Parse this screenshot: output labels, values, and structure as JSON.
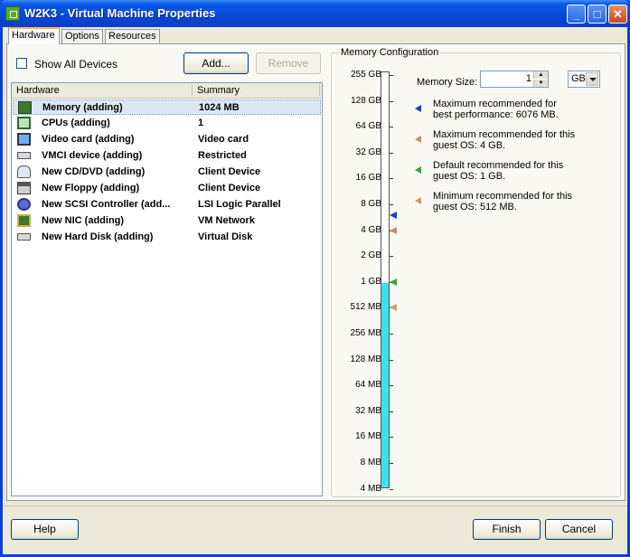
{
  "window": {
    "title": "W2K3 - Virtual Machine Properties",
    "controls": [
      "minimize-icon",
      "maximize-icon",
      "close-icon"
    ]
  },
  "tabs": [
    {
      "label": "Hardware",
      "active": true
    },
    {
      "label": "Options",
      "active": false
    },
    {
      "label": "Resources",
      "active": false
    }
  ],
  "hardware_panel": {
    "show_all_devices_label": "Show All Devices",
    "show_all_devices_checked": false,
    "add_label": "Add...",
    "remove_label": "Remove",
    "columns": [
      "Hardware",
      "Summary"
    ],
    "rows": [
      {
        "icon": "memory-icon",
        "name": "Memory (adding)",
        "summary": "1024 MB",
        "selected": true
      },
      {
        "icon": "cpu-icon",
        "name": "CPUs (adding)",
        "summary": "1",
        "selected": false
      },
      {
        "icon": "monitor-icon",
        "name": "Video card  (adding)",
        "summary": "Video card",
        "selected": false
      },
      {
        "icon": "vmci-icon",
        "name": "VMCI device (adding)",
        "summary": "Restricted",
        "selected": false
      },
      {
        "icon": "cd-dvd-icon",
        "name": "New CD/DVD (adding)",
        "summary": "Client Device",
        "selected": false
      },
      {
        "icon": "floppy-icon",
        "name": "New Floppy (adding)",
        "summary": "Client Device",
        "selected": false
      },
      {
        "icon": "scsi-controller-icon",
        "name": "New SCSI Controller (add...",
        "summary": "LSI Logic Parallel",
        "selected": false
      },
      {
        "icon": "network-card-icon",
        "name": "New NIC (adding)",
        "summary": "VM Network",
        "selected": false
      },
      {
        "icon": "hard-disk-icon",
        "name": "New Hard Disk (adding)",
        "summary": "Virtual Disk",
        "selected": false
      }
    ]
  },
  "memory": {
    "group_title": "Memory Configuration",
    "size_label": "Memory Size:",
    "size_value": "1",
    "unit": "GB",
    "scale_labels": [
      "255 GB",
      "128 GB",
      "64 GB",
      "32 GB",
      "16 GB",
      "8 GB",
      "4 GB",
      "2 GB",
      "1 GB",
      "512 MB",
      "256 MB",
      "128 MB",
      "64 MB",
      "32 MB",
      "16 MB",
      "8 MB",
      "4 MB"
    ],
    "current_value_mb": 1024,
    "markers": [
      {
        "kind": "max-best",
        "value_mb": 6076,
        "color": "#1a3ccc",
        "text": "Maximum recommended for best performance: 6076 MB."
      },
      {
        "kind": "max-guest",
        "value_mb": 4096,
        "color": "#d08a6a",
        "text": "Maximum recommended for this guest OS: 4 GB."
      },
      {
        "kind": "default",
        "value_mb": 1024,
        "color": "#3aa83a",
        "text": "Default recommended for this guest OS: 1 GB."
      },
      {
        "kind": "min",
        "value_mb": 512,
        "color": "#c8a060",
        "text": "Minimum recommended for this guest OS: 512 MB."
      }
    ]
  },
  "footer": {
    "help_label": "Help",
    "finish_label": "Finish",
    "cancel_label": "Cancel"
  }
}
